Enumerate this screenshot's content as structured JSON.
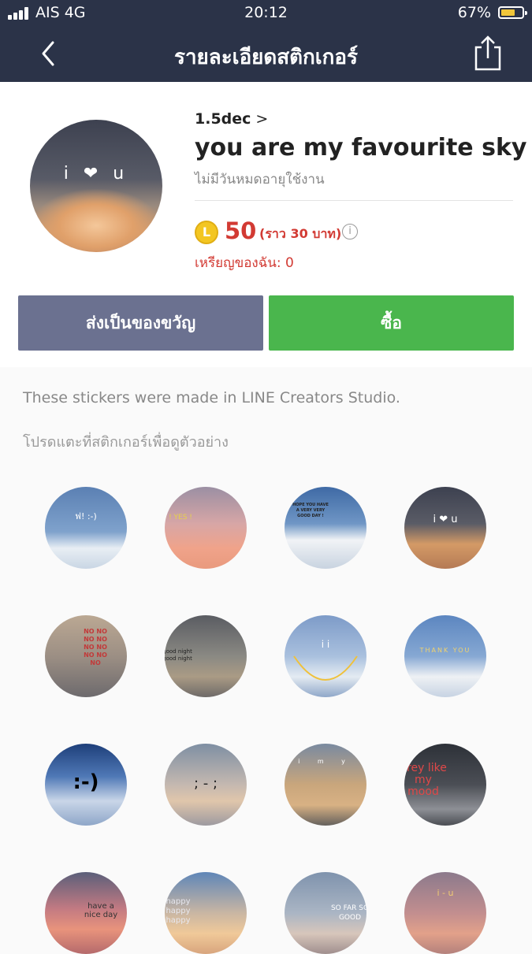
{
  "status": {
    "carrier": "AIS 4G",
    "time": "20:12",
    "battery": "67%",
    "battery_level": 0.67
  },
  "nav": {
    "title": "รายละเอียดสติกเกอร์",
    "back_icon": "chevron-left-icon",
    "share_icon": "share-icon"
  },
  "sticker_set": {
    "author": "1.5dec",
    "title": "you are my favourite sky",
    "validity": "ไม่มีวันหมดอายุใช้งาน",
    "coin_icon": "L",
    "price": "50",
    "price_approx": "(ราว  30 บาท)",
    "info_icon": "i",
    "my_coins": "เหรียญของฉัน: 0",
    "hero_text": "i ❤ u"
  },
  "buttons": {
    "gift": "ส่งเป็นของขวัญ",
    "buy": "ซื้อ"
  },
  "creators_note": "These stickers were made in LINE Creators Studio.",
  "preview_hint": "โปรดแตะที่สติกเกอร์เพื่อดูตัวอย่าง",
  "stickers": [
    {
      "text": "ฟ! :-)"
    },
    {
      "text": "YES ! YES ! YES !"
    },
    {
      "text": "HOPE YOU HAVE A VERY VERY GOOD DAY !"
    },
    {
      "text": "i ❤ u"
    },
    {
      "text": "NO NO NO NO NO NO NO NO NO"
    },
    {
      "text": "good night good night"
    },
    {
      "text": "i   i"
    },
    {
      "text": "THANK YOU"
    },
    {
      "text": ":-)"
    },
    {
      "text": "; - ;"
    },
    {
      "text": "i  m  y"
    },
    {
      "text": "grey like my mood"
    },
    {
      "text": "have a nice day"
    },
    {
      "text": "happy happy happy"
    },
    {
      "text": "SO FAR SO GOOD"
    },
    {
      "text": "i - u"
    }
  ]
}
